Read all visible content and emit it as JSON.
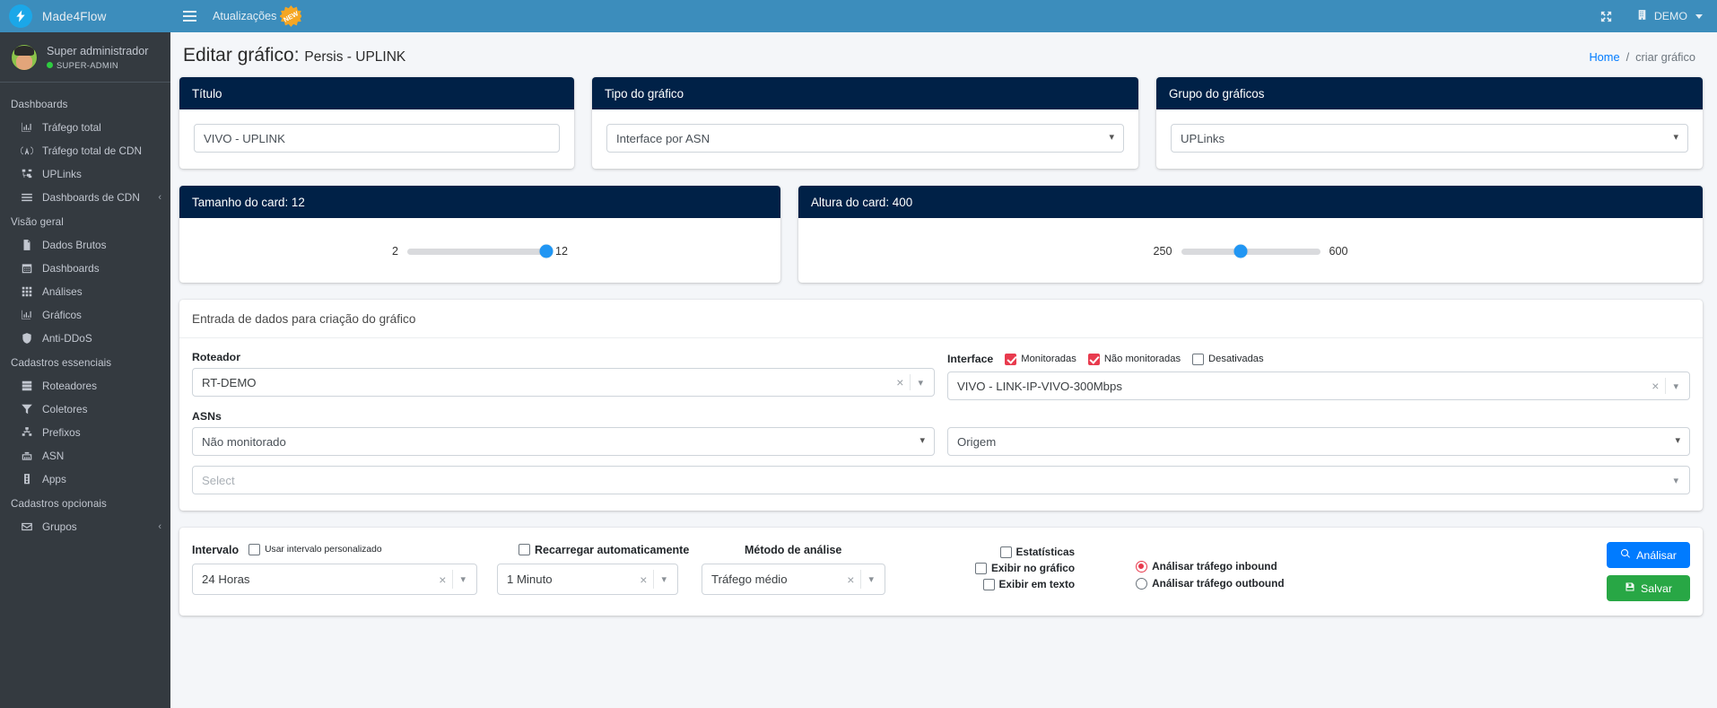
{
  "brand": {
    "name": "Made4Flow",
    "logo_icon": "lightning-logo-icon"
  },
  "user": {
    "name": "Super administrador",
    "role": "SUPER-ADMIN"
  },
  "topbar": {
    "menu_icon": "hamburger-icon",
    "updates_label": "Atualizações",
    "new_badge": "NEW",
    "expand_icon": "expand-arrows-icon",
    "company_icon": "building-icon",
    "company_label": "DEMO"
  },
  "page": {
    "title_prefix": "Editar gráfico:",
    "title_value": "Persis - UPLINK",
    "breadcrumb_home": "Home",
    "breadcrumb_sep": "/",
    "breadcrumb_current": "criar gráfico"
  },
  "sidebar": {
    "groups": [
      {
        "header": "Dashboards",
        "items": [
          {
            "label": "Tráfego total",
            "icon": "bar-chart-icon"
          },
          {
            "label": "Tráfego total de CDN",
            "icon": "broadcast-icon"
          },
          {
            "label": "UPLinks",
            "icon": "network-tree-icon"
          },
          {
            "label": "Dashboards de CDN",
            "icon": "list-icon",
            "chevron": "‹"
          }
        ]
      },
      {
        "header": "Visão geral",
        "items": [
          {
            "label": "Dados Brutos",
            "icon": "file-text-icon"
          },
          {
            "label": "Dashboards",
            "icon": "calendar-icon"
          },
          {
            "label": "Análises",
            "icon": "grid-icon"
          },
          {
            "label": "Gráficos",
            "icon": "bar-chart-icon"
          },
          {
            "label": "Anti-DDoS",
            "icon": "shield-icon"
          }
        ]
      },
      {
        "header": "Cadastros essenciais",
        "items": [
          {
            "label": "Roteadores",
            "icon": "server-icon"
          },
          {
            "label": "Coletores",
            "icon": "filter-icon"
          },
          {
            "label": "Prefixos",
            "icon": "sitemap-icon"
          },
          {
            "label": "ASN",
            "icon": "ethernet-icon"
          },
          {
            "label": "Apps",
            "icon": "traffic-light-icon"
          }
        ]
      },
      {
        "header": "Cadastros opcionais",
        "items": [
          {
            "label": "Grupos",
            "icon": "envelope-icon",
            "chevron": "‹"
          }
        ]
      }
    ]
  },
  "cards": {
    "titulo": {
      "header": "Título",
      "value": "VIVO - UPLINK",
      "placeholder": ""
    },
    "tipo": {
      "header": "Tipo do gráfico",
      "value": "Interface por ASN"
    },
    "grupo": {
      "header": "Grupo do gráficos",
      "value": "UPLinks"
    },
    "tamanho": {
      "header": "Tamanho do card: 12",
      "min_label": "2",
      "max_label": "12",
      "min": 2,
      "max": 12,
      "value": 12
    },
    "altura": {
      "header": "Altura do card: 400",
      "min_label": "250",
      "max_label": "600",
      "min": 250,
      "max": 600,
      "value": 400
    }
  },
  "form": {
    "panel_title": "Entrada de dados para criação do gráfico",
    "roteador_label": "Roteador",
    "roteador_value": "RT-DEMO",
    "interface_label": "Interface",
    "interface_checks": [
      {
        "label": "Monitoradas",
        "checked": true
      },
      {
        "label": "Não monitoradas",
        "checked": true
      },
      {
        "label": "Desativadas",
        "checked": false
      }
    ],
    "interface_value": "VIVO - LINK-IP-VIVO-300Mbps",
    "asns_label": "ASNs",
    "asns_value": "Não monitorado",
    "origem_value": "Origem",
    "select_placeholder": "Select"
  },
  "bottom": {
    "intervalo_label": "Intervalo",
    "intervalo_custom_label": "Usar intervalo personalizado",
    "intervalo_custom_checked": false,
    "intervalo_value": "24 Horas",
    "recarregar_label": "Recarregar automaticamente",
    "recarregar_checked": false,
    "recarregar_value": "1 Minuto",
    "metodo_label": "Método de análise",
    "metodo_value": "Tráfego médio",
    "checks": [
      {
        "label": "Estatísticas",
        "checked": false
      },
      {
        "label": "Exibir no gráfico",
        "checked": false
      },
      {
        "label": "Exibir em texto",
        "checked": false
      }
    ],
    "radios": [
      {
        "label": "Análisar tráfego inbound",
        "selected": true
      },
      {
        "label": "Análisar tráfego outbound",
        "selected": false
      }
    ],
    "analisar_label": "Análisar",
    "analisar_icon": "search-icon",
    "salvar_label": "Salvar",
    "salvar_icon": "save-icon"
  },
  "colors": {
    "topbar": "#3c8dbc",
    "sidebar": "#343a40",
    "card_header": "#002147",
    "accent_red": "#e83b4e",
    "primary": "#007bff",
    "success": "#28a745",
    "slider_knob": "#2196f3"
  }
}
